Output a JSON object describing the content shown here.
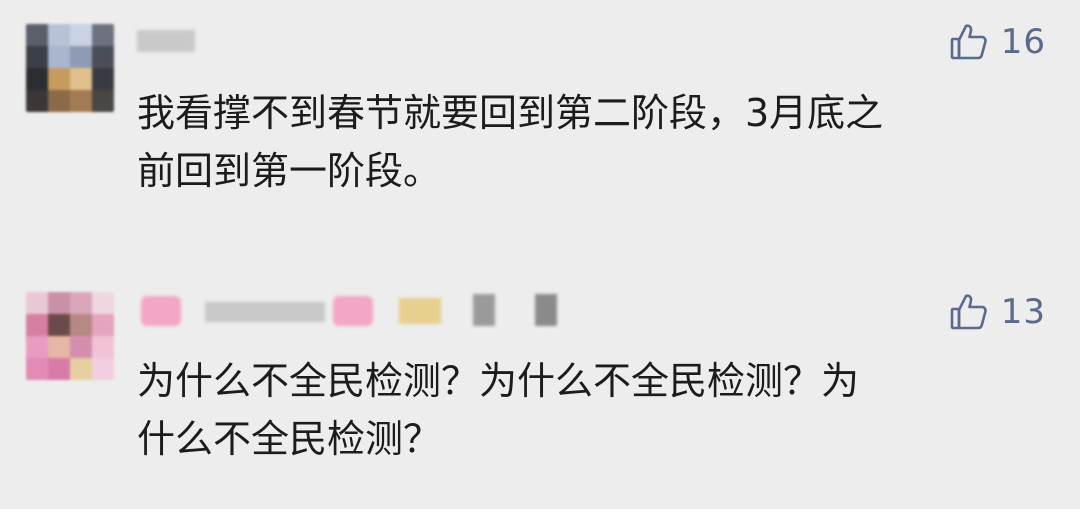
{
  "comments": [
    {
      "likes": "16",
      "text_line1": "我看撑不到春节就要回到第二阶段，3月底之",
      "text_line2": "前回到第一阶段。"
    },
    {
      "likes": "13",
      "text_line1": "为什么不全民检测？为什么不全民检测？为",
      "text_line2": "什么不全民检测？"
    }
  ],
  "colors": {
    "background": "#ededed",
    "like_accent": "#596a8c",
    "text": "#1c1c1c"
  },
  "icons": {
    "like": "thumbs-up-icon"
  }
}
